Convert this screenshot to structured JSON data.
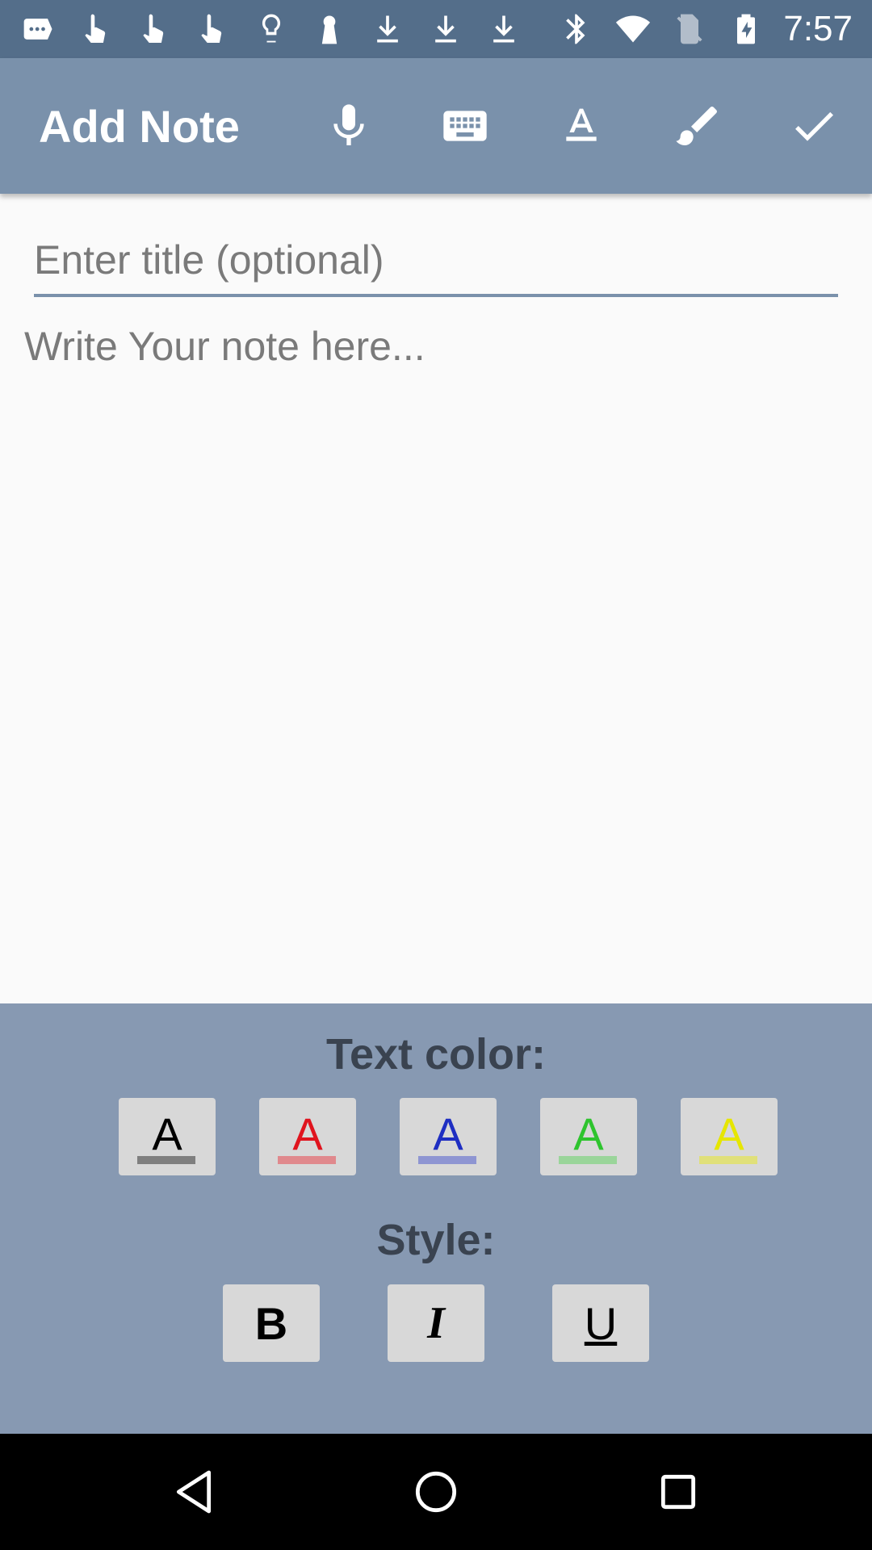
{
  "status_bar": {
    "time": "7:57",
    "left_icons": [
      "message-icon",
      "touch-icon",
      "touch-icon",
      "touch-icon",
      "lightbulb-icon",
      "keyhole-icon",
      "download-icon",
      "download-icon",
      "download-icon"
    ],
    "right_icons": [
      "bluetooth-icon",
      "wifi-icon",
      "no-sim-icon",
      "battery-charging-icon"
    ]
  },
  "app_bar": {
    "title": "Add Note",
    "actions": [
      "microphone-icon",
      "keyboard-icon",
      "text-format-icon",
      "brush-icon",
      "check-icon"
    ]
  },
  "editor": {
    "title_placeholder": "Enter title (optional)",
    "title_value": "",
    "body_placeholder": "Write Your note here...",
    "body_value": ""
  },
  "format_panel": {
    "text_color_heading": "Text color:",
    "colors": [
      {
        "letter": "A",
        "text_color": "#000000",
        "bar_color": "#7f7f7f",
        "name": "black"
      },
      {
        "letter": "A",
        "text_color": "#e0141e",
        "bar_color": "#e0898d",
        "name": "red"
      },
      {
        "letter": "A",
        "text_color": "#1e2ec2",
        "bar_color": "#8e95d2",
        "name": "blue"
      },
      {
        "letter": "A",
        "text_color": "#2ec42e",
        "bar_color": "#9ad59a",
        "name": "green"
      },
      {
        "letter": "A",
        "text_color": "#e6e600",
        "bar_color": "#e0e07a",
        "name": "yellow"
      }
    ],
    "style_heading": "Style:",
    "styles": [
      {
        "label": "B",
        "name": "bold"
      },
      {
        "label": "I",
        "name": "italic"
      },
      {
        "label": "U",
        "name": "underline"
      }
    ]
  },
  "nav_bar": {
    "buttons": [
      "back-icon",
      "home-icon",
      "recents-icon"
    ]
  },
  "colors": {
    "status_bar": "#546e8a",
    "app_bar": "#7a91ab",
    "panel": "#8799b2",
    "panel_heading": "#3a4350",
    "button_bg": "#d8d8d8"
  }
}
